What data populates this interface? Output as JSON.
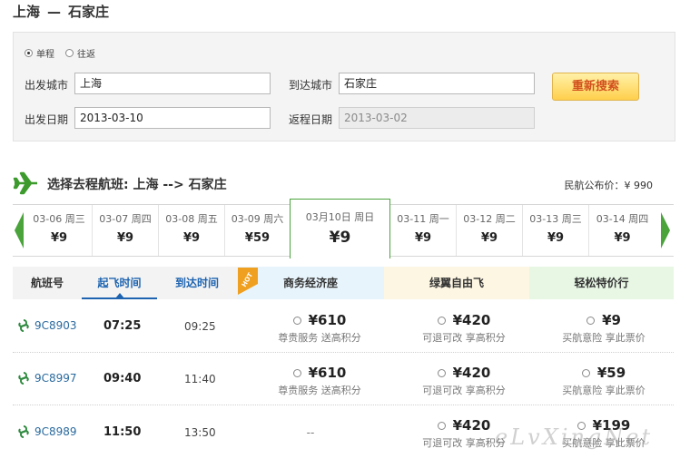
{
  "header": {
    "origin": "上海",
    "separator": "—",
    "destination": "石家庄"
  },
  "search": {
    "trip_types": [
      {
        "label": "单程",
        "checked": true
      },
      {
        "label": "往返",
        "checked": false
      }
    ],
    "depart_city_label": "出发城市",
    "depart_city_value": "上海",
    "arrive_city_label": "到达城市",
    "arrive_city_value": "石家庄",
    "depart_date_label": "出发日期",
    "depart_date_value": "2013-03-10",
    "return_date_label": "返程日期",
    "return_date_value": "2013-03-02",
    "search_button": "重新搜索"
  },
  "section": {
    "title": "选择去程航班: 上海 --> 石家庄",
    "public_price": "民航公布价：¥ 990",
    "icon": "plane-icon"
  },
  "dates": [
    {
      "date": "03-06 周三",
      "price": "¥9"
    },
    {
      "date": "03-07 周四",
      "price": "¥9"
    },
    {
      "date": "03-08 周五",
      "price": "¥9"
    },
    {
      "date": "03-09 周六",
      "price": "¥59"
    },
    {
      "date": "03月10日 周日",
      "price": "¥9",
      "active": true
    },
    {
      "date": "03-11 周一",
      "price": "¥9"
    },
    {
      "date": "03-12 周二",
      "price": "¥9"
    },
    {
      "date": "03-13 周三",
      "price": "¥9"
    },
    {
      "date": "03-14 周四",
      "price": "¥9"
    }
  ],
  "table": {
    "headers": {
      "flight_no": "航班号",
      "depart_time": "起飞时间",
      "arrive_time": "到达时间",
      "business": "商务经济座",
      "green": "绿翼自由飞",
      "easy": "轻松特价行",
      "hot": "HOT"
    },
    "rows": [
      {
        "flight": "9C8903",
        "dep": "07:25",
        "arr": "09:25",
        "business": {
          "price": "¥610",
          "note": "尊贵服务 送高积分"
        },
        "green": {
          "price": "¥420",
          "note": "可退可改 享高积分"
        },
        "easy": {
          "price": "¥9",
          "note": "买航意险 享此票价"
        }
      },
      {
        "flight": "9C8997",
        "dep": "09:40",
        "arr": "11:40",
        "business": {
          "price": "¥610",
          "note": "尊贵服务 送高积分"
        },
        "green": {
          "price": "¥420",
          "note": "可退可改 享高积分"
        },
        "easy": {
          "price": "¥59",
          "note": "买航意险 享此票价"
        }
      },
      {
        "flight": "9C8989",
        "dep": "11:50",
        "arr": "13:50",
        "business": {
          "empty": "--"
        },
        "green": {
          "price": "¥420",
          "note": "可退可改 享高积分"
        },
        "easy": {
          "price": "¥199",
          "note": "买航意险 享此票价"
        }
      }
    ]
  },
  "watermark": "eLvXingNet",
  "colors": {
    "accent_green": "#4aa33b",
    "link_blue": "#1d63b0",
    "button_text": "#d2501d"
  }
}
